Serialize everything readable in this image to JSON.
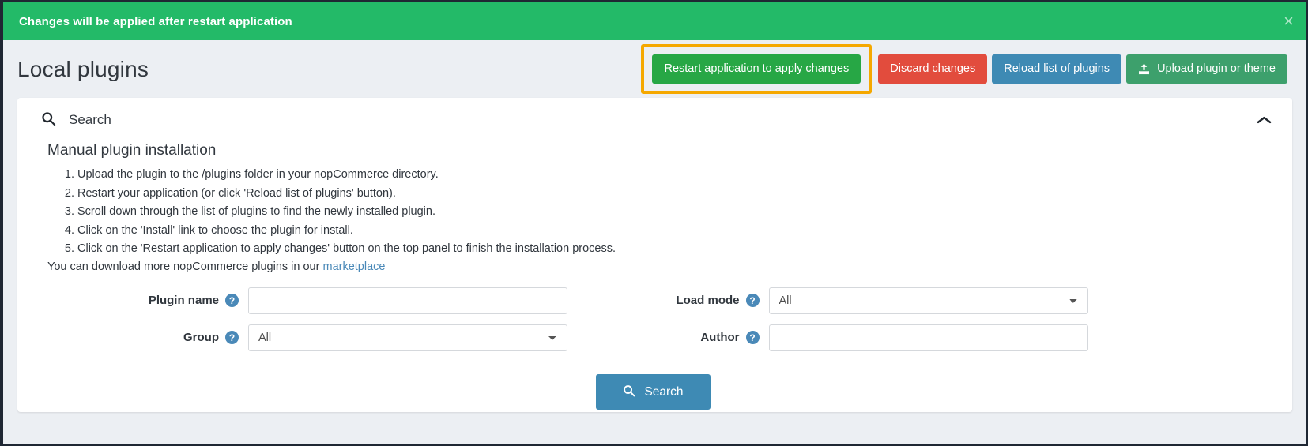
{
  "notification": {
    "message": "Changes will be applied after restart application",
    "close_label": "×",
    "background": "#23ba68"
  },
  "header": {
    "title": "Local plugins",
    "buttons": {
      "restart": "Restart application to apply changes",
      "discard": "Discard changes",
      "reload": "Reload list of plugins",
      "upload": "Upload plugin or theme"
    },
    "highlight_color": "#f5a800"
  },
  "panel": {
    "search_label": "Search",
    "manual_title": "Manual plugin installation",
    "steps": [
      "Upload the plugin to the /plugins folder in your nopCommerce directory.",
      "Restart your application (or click 'Reload list of plugins' button).",
      "Scroll down through the list of plugins to find the newly installed plugin.",
      "Click on the 'Install' link to choose the plugin for install.",
      "Click on the 'Restart application to apply changes' button on the top panel to finish the installation process."
    ],
    "download_text": "You can download more nopCommerce plugins in our ",
    "download_link": "marketplace"
  },
  "form": {
    "plugin_name": {
      "label": "Plugin name",
      "value": "",
      "placeholder": ""
    },
    "group": {
      "label": "Group",
      "value": "All",
      "options": [
        "All"
      ]
    },
    "load_mode": {
      "label": "Load mode",
      "value": "All",
      "options": [
        "All"
      ]
    },
    "author": {
      "label": "Author",
      "value": "",
      "placeholder": ""
    },
    "hint_glyph": "?",
    "search_button": "Search"
  }
}
